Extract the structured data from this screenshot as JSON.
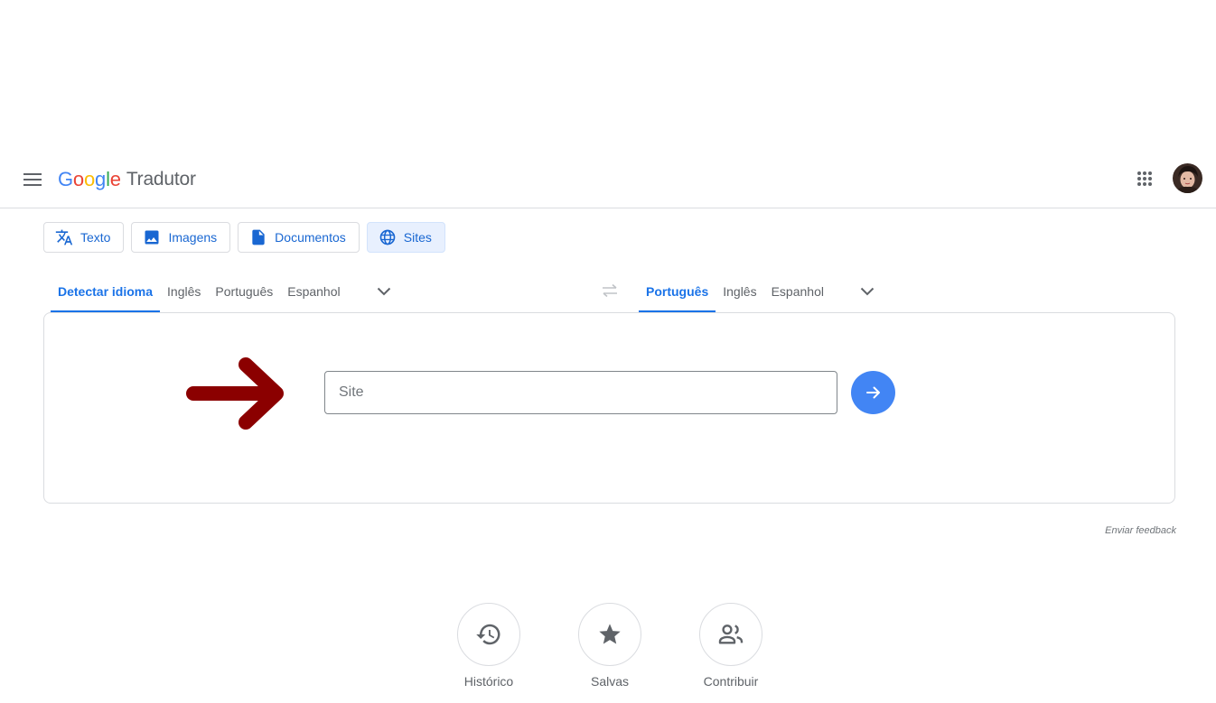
{
  "header": {
    "logo": {
      "letters": [
        {
          "char": "G",
          "color": "#4285f4"
        },
        {
          "char": "o",
          "color": "#ea4335"
        },
        {
          "char": "o",
          "color": "#fbbc05"
        },
        {
          "char": "g",
          "color": "#4285f4"
        },
        {
          "char": "l",
          "color": "#34a853"
        },
        {
          "char": "e",
          "color": "#ea4335"
        }
      ],
      "product_name": "Tradutor"
    },
    "menu_icon": "hamburger-menu-icon",
    "apps_icon": "apps-grid-icon"
  },
  "modes": [
    {
      "label": "Texto",
      "icon": "translate-icon",
      "active": false
    },
    {
      "label": "Imagens",
      "icon": "image-icon",
      "active": false
    },
    {
      "label": "Documentos",
      "icon": "document-icon",
      "active": false
    },
    {
      "label": "Sites",
      "icon": "globe-icon",
      "active": true
    }
  ],
  "source_languages": {
    "items": [
      "Detectar idioma",
      "Inglês",
      "Português",
      "Espanhol"
    ],
    "selected": "Detectar idioma"
  },
  "target_languages": {
    "items": [
      "Português",
      "Inglês",
      "Espanhol"
    ],
    "selected": "Português"
  },
  "site_input": {
    "placeholder": "Site",
    "value": ""
  },
  "feedback_link": "Enviar feedback",
  "actions": [
    {
      "label": "Histórico",
      "icon": "history-icon"
    },
    {
      "label": "Salvas",
      "icon": "star-icon"
    },
    {
      "label": "Contribuir",
      "icon": "people-icon"
    }
  ],
  "colors": {
    "accent": "#1a73e8",
    "go_button": "#4285f4",
    "annotation_arrow": "#8b0000"
  }
}
